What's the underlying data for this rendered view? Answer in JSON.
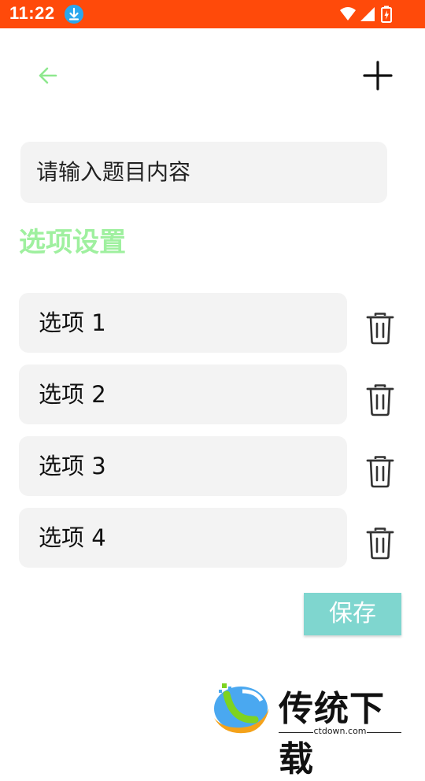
{
  "status_bar": {
    "time": "11:22",
    "icons": [
      "download-notification-icon",
      "wifi-icon",
      "signal-icon",
      "battery-charging-icon"
    ]
  },
  "toolbar": {
    "back_icon": "arrow-left-icon",
    "add_icon": "plus-icon"
  },
  "question": {
    "placeholder": "请输入题目内容"
  },
  "section": {
    "title": "选项设置"
  },
  "options": [
    {
      "label": "选项 1",
      "delete_icon": "trash-icon"
    },
    {
      "label": "选项 2",
      "delete_icon": "trash-icon"
    },
    {
      "label": "选项 3",
      "delete_icon": "trash-icon"
    },
    {
      "label": "选项 4",
      "delete_icon": "trash-icon"
    }
  ],
  "save_label": "保存",
  "watermark": {
    "brand": "传统下载",
    "domain": "ctdown.com"
  },
  "colors": {
    "status_bar": "#ff4a0a",
    "accent_green": "#9ff09f",
    "save_button": "#7fd6cf",
    "field_bg": "#f3f3f3"
  }
}
